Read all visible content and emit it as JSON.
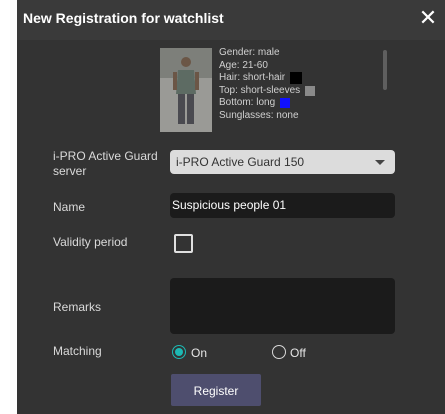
{
  "dialog": {
    "title": "New Registration for watchlist",
    "close_icon": "close-icon"
  },
  "person": {
    "photo_icon": "person-photo",
    "attributes": {
      "gender": "Gender: male",
      "age": "Age: 21-60",
      "hair": "Hair: short-hair",
      "hair_color": "#000000",
      "top": "Top: short-sleeves",
      "top_color": "#8a8a8a",
      "bottom": "Bottom: long",
      "bottom_color": "#1010ff",
      "sunglasses": "Sunglasses: none"
    }
  },
  "form": {
    "server_label_line1": "i-PRO Active Guard",
    "server_label_line2": "server",
    "server_value": "i-PRO Active Guard 150",
    "name_label": "Name",
    "name_value": "Suspicious people 01",
    "validity_label": "Validity period",
    "validity_checked": false,
    "remarks_label": "Remarks",
    "remarks_value": "",
    "matching_label": "Matching",
    "matching_on": "On",
    "matching_off": "Off",
    "matching_selected": "On",
    "accent_color": "#1db9b3"
  },
  "actions": {
    "register_label": "Register"
  }
}
